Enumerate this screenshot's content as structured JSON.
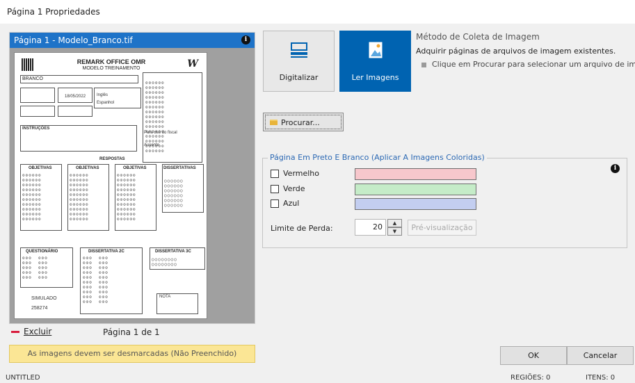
{
  "window": {
    "title": "Página 1 Propriedades"
  },
  "preview": {
    "header_title": "Página 1 - Modelo_Branco.tif",
    "info_icon": "info-icon",
    "sheet": {
      "title": "REMARK OFFICE OMR",
      "subtitle": "MODELO TREINAMENTO",
      "name": "BRANCO",
      "logo": "W",
      "section_answers": "RESPOSTAS",
      "col1": "OBJETIVAS",
      "col2": "OBJETIVAS",
      "col3": "OBJETIVAS",
      "col4": "DISSERTATIVAS",
      "date": "18/05/2022",
      "lang1": "Inglês",
      "lang2": "Espanhol",
      "absent": "Ausente",
      "absent_note": "Para uso do fiscal",
      "instructions_title": "INSTRUÇÕES",
      "simulado_label": "SIMULADO",
      "simulado_number": "258274",
      "sec_a": "QUESTIONÁRIO",
      "sec_b": "DISSERTATIVA 2C",
      "sec_c": "DISSERTATIVA 3C",
      "sec_d": "NOTA"
    },
    "delete_label": "Excluir",
    "page_count": "Página 1 de 1",
    "warning": "As imagens devem ser desmarcadas (Não Preenchido)"
  },
  "method": {
    "scan_label": "Digitalizar",
    "scan_underline": "D",
    "read_label": "Ler Imagens",
    "read_underline": "I",
    "title": "Método de Coleta de Imagem",
    "description": "Adquirir páginas de arquivos de imagem existentes.",
    "hint": "Clique em Procurar para selecionar um arquivo de imag"
  },
  "browse": {
    "label": "Procurar..."
  },
  "bw_group": {
    "legend": "Página Em Preto E Branco (Aplicar A Imagens Coloridas)",
    "checkboxes": [
      {
        "label": "Vermelho",
        "checked": false,
        "color": "#f7c7cc"
      },
      {
        "label": "Verde",
        "checked": false,
        "color": "#c5ecc8"
      },
      {
        "label": "Azul",
        "checked": false,
        "color": "#c3cef0"
      }
    ],
    "limit_label": "Limite de Perda:",
    "limit_value": "20",
    "preview_button": "Pré-visualização"
  },
  "actions": {
    "ok": "OK",
    "cancel": "Cancelar"
  },
  "status": {
    "left": "UNTITLED",
    "regions": "REGIÕES: 0",
    "items": "ITENS: 0"
  },
  "colors": {
    "accent": "#0063b1",
    "header_blue": "#1e73c8",
    "warning_bg": "#fbe695",
    "delete_red": "#d81b3b"
  }
}
